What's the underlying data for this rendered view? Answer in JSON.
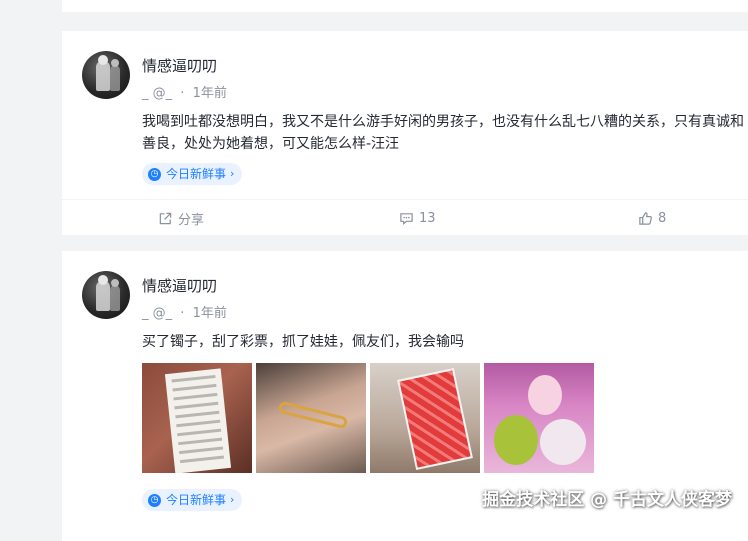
{
  "posts": [
    {
      "username": "情感逼叨叨",
      "handle": "_ @_",
      "time": "1年前",
      "content": "我喝到吐都没想明白，我又不是什么游手好闲的男孩子，也没有什么乱七八糟的关系，只有真诚和善良，处处为她着想，可又能怎么样-汪汪",
      "topic": "今日新鲜事",
      "share_label": "分享",
      "comments": "13",
      "likes": "8"
    },
    {
      "username": "情感逼叨叨",
      "handle": "_ @_",
      "time": "1年前",
      "content": "买了镯子，刮了彩票，抓了娃娃，佩友们，我会输吗",
      "topic": "今日新鲜事"
    }
  ],
  "icons": {
    "topic": "topic-icon",
    "chevron": "chevron-right-icon",
    "share": "share-icon",
    "comment": "comment-icon",
    "like": "like-icon"
  },
  "colors": {
    "accent": "#1e80ff",
    "muted": "#8a919f",
    "background": "#f2f3f5"
  },
  "watermark": "掘金技术社区 @ 千古文人侠客梦"
}
